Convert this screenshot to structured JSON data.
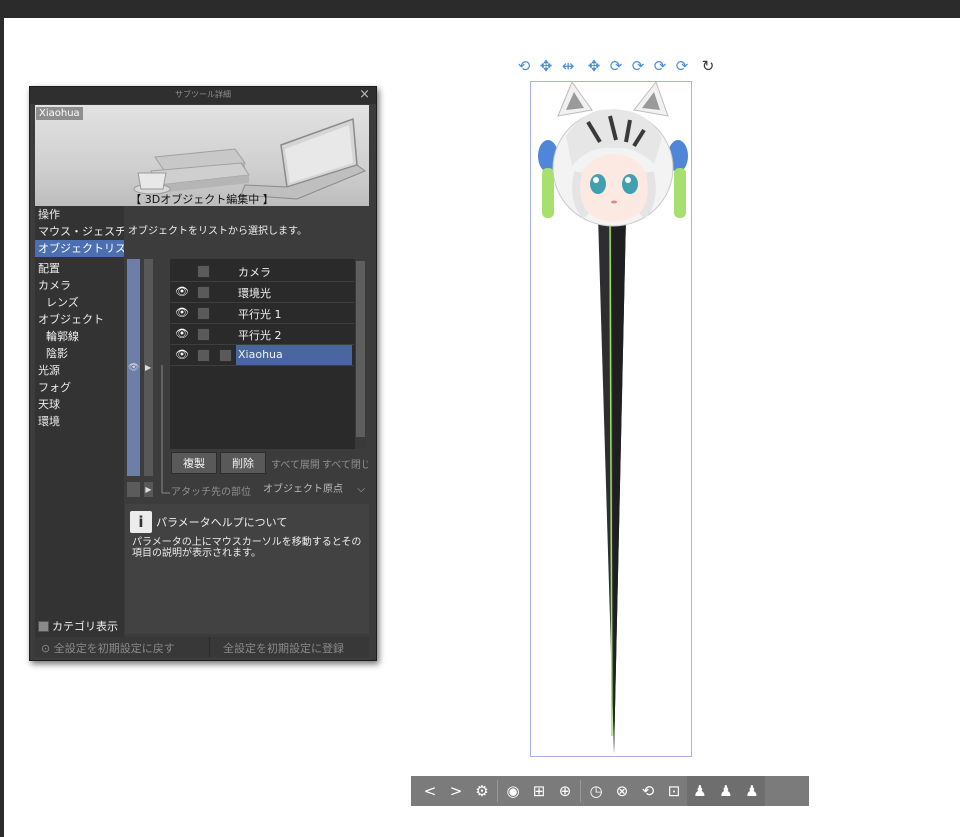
{
  "panel": {
    "title": "サブツール詳細",
    "close_label": "×",
    "preview_tag": "Xiaohua",
    "preview_banner": "【 3Dオブジェクト編集中 】",
    "categories": [
      {
        "label": "操作"
      },
      {
        "label": "マウス・ジェスチャー"
      },
      {
        "label": "オブジェクトリスト"
      },
      {
        "label": "配置"
      },
      {
        "label": "カメラ"
      },
      {
        "label": "レンズ"
      },
      {
        "label": "オブジェクト"
      },
      {
        "label": "輪郭線"
      },
      {
        "label": "陰影"
      },
      {
        "label": "光源"
      },
      {
        "label": "フォグ"
      },
      {
        "label": "天球"
      },
      {
        "label": "環境"
      }
    ],
    "selected_category": "オブジェクトリスト",
    "category_display_label": "カテゴリ表示",
    "description": "オブジェクトをリストから選択します。",
    "objects": [
      {
        "label": "カメラ",
        "visible": false
      },
      {
        "label": "環境光",
        "visible": true
      },
      {
        "label": "平行光 1",
        "visible": true
      },
      {
        "label": "平行光 2",
        "visible": true
      },
      {
        "label": "Xiaohua",
        "visible": true,
        "selected": true
      }
    ],
    "eye_icon": "👁",
    "duplicate_label": "複製",
    "delete_label": "削除",
    "expand_all_label": "すべて展開",
    "collapse_all_label": "すべて閉じる",
    "attach_label": "アタッチ先の部位",
    "origin_label": "オブジェクト原点",
    "help_icon": "i",
    "help_title": "パラメータヘルプについて",
    "help_body": "パラメータの上にマウスカーソルを移動するとその項目の説明が表示されます。",
    "reset_all_label": "全設定を初期設定に戻す",
    "register_all_label": "全設定を初期設定に登録"
  },
  "top_toolbar": [
    {
      "name": "rotate-camera-icon",
      "glyph": "⟲"
    },
    {
      "name": "pan-camera-icon",
      "glyph": "✥"
    },
    {
      "name": "dolly-camera-icon",
      "glyph": "⇹"
    },
    {
      "name": "move-object-icon",
      "glyph": "✥"
    },
    {
      "name": "rotate-object-icon",
      "glyph": "⟳"
    },
    {
      "name": "rotate-object-2-icon",
      "glyph": "⟳"
    },
    {
      "name": "rotate-object-3-icon",
      "glyph": "⟳"
    },
    {
      "name": "rotate-object-4-icon",
      "glyph": "⟳"
    },
    {
      "name": "rotate-light-icon",
      "glyph": "↻"
    }
  ],
  "bottom_toolbar": {
    "prev_glyph": "<",
    "next_glyph": ">",
    "wrench_glyph": "⚙",
    "group1": [
      "◉",
      "⊞",
      "⊕"
    ],
    "group2": [
      "◷",
      "⊗",
      "⟲",
      "⊡"
    ],
    "group3": [
      "♟",
      "♟",
      "♟"
    ]
  },
  "colors": {
    "accent": "#4b6fb0",
    "toolbar_blue": "#4a8fd4"
  }
}
